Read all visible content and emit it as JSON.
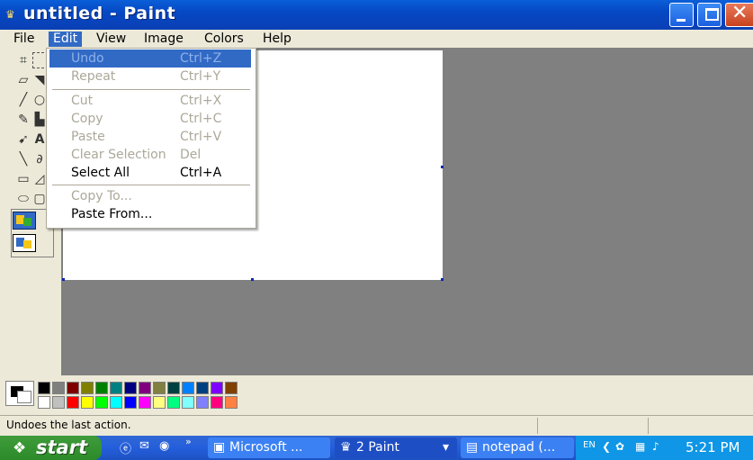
{
  "window": {
    "title": "untitled - Paint"
  },
  "menubar": {
    "file": "File",
    "edit": "Edit",
    "view": "View",
    "image": "Image",
    "colors": "Colors",
    "help": "Help"
  },
  "edit_menu": {
    "items": [
      {
        "label": "Undo",
        "shortcut": "Ctrl+Z",
        "enabled": false,
        "highlighted": true
      },
      {
        "label": "Repeat",
        "shortcut": "Ctrl+Y",
        "enabled": false
      },
      {
        "label": "Cut",
        "shortcut": "Ctrl+X",
        "enabled": false
      },
      {
        "label": "Copy",
        "shortcut": "Ctrl+C",
        "enabled": false
      },
      {
        "label": "Paste",
        "shortcut": "Ctrl+V",
        "enabled": false
      },
      {
        "label": "Clear Selection",
        "shortcut": "Del",
        "enabled": false
      },
      {
        "label": "Select All",
        "shortcut": "Ctrl+A",
        "enabled": true
      },
      {
        "label": "Copy To...",
        "shortcut": "",
        "enabled": false
      },
      {
        "label": "Paste From...",
        "shortcut": "",
        "enabled": true
      }
    ]
  },
  "palette": {
    "foreground": "#000000",
    "background": "#ffffff",
    "row1": [
      "#000000",
      "#808080",
      "#800000",
      "#808000",
      "#008000",
      "#008080",
      "#000080",
      "#800080",
      "#808040",
      "#004040",
      "#0080ff",
      "#004080",
      "#8000ff",
      "#804000"
    ],
    "row2": [
      "#ffffff",
      "#c0c0c0",
      "#ff0000",
      "#ffff00",
      "#00ff00",
      "#00ffff",
      "#0000ff",
      "#ff00ff",
      "#ffff80",
      "#00ff80",
      "#80ffff",
      "#8080ff",
      "#ff0080",
      "#ff8040"
    ]
  },
  "status": {
    "text": "Undoes the last action."
  },
  "taskbar": {
    "start": "start",
    "tasks": [
      {
        "label": "Microsoft ...",
        "icon": "outlook-icon"
      },
      {
        "label": "2 Paint",
        "icon": "paint-icon"
      },
      {
        "label": "notepad (...",
        "icon": "notepad-icon"
      }
    ],
    "tray": {
      "lang": "EN",
      "clock": "5:21 PM"
    }
  }
}
